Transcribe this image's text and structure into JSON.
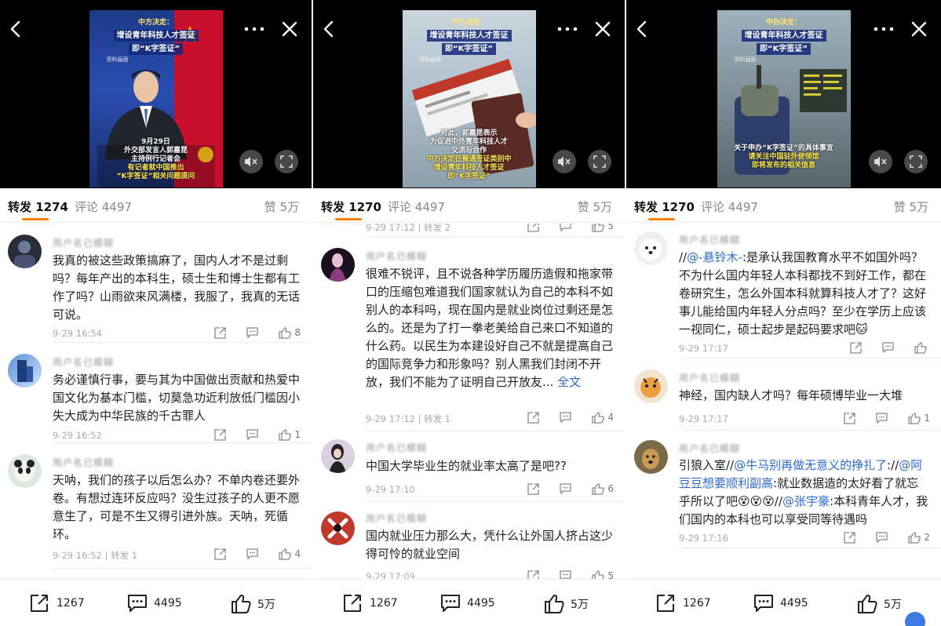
{
  "panels": [
    {
      "video": {
        "caption_top": [
          "中方决定：",
          "增设青年科技人才签证",
          "即“K字签证”"
        ],
        "watermark": "资料画面",
        "caption_bottom": [
          "9月29日",
          "外交部发言人郭嘉昆",
          "主持例行记者会",
          "有记者就中国推出",
          "“K字签证”相关问题提问"
        ]
      },
      "tabs": {
        "repost": "转发 1274",
        "comment": "评论 4497",
        "like": "赞 5万"
      },
      "comments": [
        {
          "name": "用户名已模糊",
          "text": "我真的被这些政策搞麻了，国内人才不是过剩吗？每年产出的本科生，硕士生和博士生都有工作了吗？山雨欲来风满楼，我服了，我真的无话可说。",
          "time": "9-29 16:54",
          "reposts": "",
          "likes": "8"
        },
        {
          "name": "用户名已模糊",
          "text": "务必谨慎行事，要与其为中国做出贡献和热爱中国文化为基本门槛，切莫急功近利放低门槛因小失大成为中华民族的千古罪人",
          "time": "9-29 16:52",
          "reposts": "",
          "likes": "1"
        },
        {
          "name": "用户名已模糊",
          "text": "天呐，我们的孩子以后怎么办？不单内卷还要外卷。有想过连环反应吗？没生过孩子的人更不愿意生了，可是不生又得引进外族。天呐，死循环。",
          "time": "9-29 16:52",
          "reposts": "转发 1",
          "likes": "4"
        }
      ],
      "bottom": {
        "repost": "1267",
        "comment": "4495",
        "like": "5万"
      }
    },
    {
      "video": {
        "caption_top": [
          "中方决定：",
          "增设青年科技人才签证",
          "即“K字签证”"
        ],
        "watermark": "资料画面",
        "caption_bottom": [
          "对此，郭嘉昆表示",
          "为促进中外青年科技人才",
          "交流与合作",
          "中方决定在普通签证类别中",
          "增设青年科技人才签证",
          "即“K字签证”"
        ]
      },
      "tabs": {
        "repost": "转发 1270",
        "comment": "评论 4497",
        "like": "赞 5万"
      },
      "top_meta": {
        "time": "9-29 17:12",
        "reposts": "转发 2",
        "likes": "5"
      },
      "comments": [
        {
          "name": "用户名已模糊",
          "text": "很难不锐评，且不说各种学历履历造假和拖家带口的压缩包难道我们国家就认为自己的本科不如别人的本科吗，现在国内是就业岗位过剩还是怎么的。还是为了打一拳老美给自己来口不知道的什么药。以民生为本建设好自己不就是提高自己的国际竞争力和形象吗？别人黑我们封闭不开放，我们不能为了证明自己开放友...",
          "more": "全文",
          "time": "9-29 17:12",
          "reposts": "转发 1",
          "likes": "4"
        },
        {
          "name": "用户名已模糊",
          "text": "中国大学毕业生的就业率太高了是吧??",
          "time": "9-29 17:10",
          "reposts": "",
          "likes": "6"
        },
        {
          "name": "用户名已模糊",
          "text": "国内就业压力那么大，凭什么让外国人挤占这少得可怜的就业空间",
          "time": "9-29 17:09",
          "reposts": "",
          "likes": "5"
        }
      ],
      "bottom": {
        "repost": "1267",
        "comment": "4495",
        "like": "5万"
      }
    },
    {
      "video": {
        "caption_top": [
          "中办决定：",
          "增设青年科技人才签证",
          "即“K字签证”"
        ],
        "watermark": "资料画面",
        "caption_bottom": [
          "关于申办“K字签证”的具体事宜",
          "请关注中国驻外使领馆",
          "即将发布的相关信息"
        ]
      },
      "tabs": {
        "repost": "转发 1270",
        "comment": "评论 4497",
        "like": "赞 5万"
      },
      "comments": [
        {
          "name": "用户名已模糊",
          "text_parts": [
            {
              "t": "//",
              "link": false
            },
            {
              "t": "@-悬铃木-",
              "link": true
            },
            {
              "t": ":是承认我国教育水平不如国外吗？不为什么国内年轻人本科都找不到好工作，都在卷研究生，怎么外国本科就算科技人才了？这好事儿能给国内年轻人分点吗？至少在学历上应该一视同仁，硕士起步是起码要求吧🐱",
              "link": false
            }
          ],
          "time": "9-29 17:17",
          "reposts": "",
          "likes": ""
        },
        {
          "name": "用户名已模糊",
          "text_parts": [
            {
              "t": "神经，国内缺人才吗？每年硕博毕业一大堆",
              "link": false
            }
          ],
          "time": "9-29 17:17",
          "reposts": "",
          "likes": "1"
        },
        {
          "name": "用户名已模糊",
          "text_parts": [
            {
              "t": "引狼入室//",
              "link": false
            },
            {
              "t": "@牛马别再做无意义的挣扎了",
              "link": true
            },
            {
              "t": "://",
              "link": false
            },
            {
              "t": "@阿豆豆想要顺利副高",
              "link": true
            },
            {
              "t": ":就业数据造的太好看了就忘乎所以了吧😵😵😵//",
              "link": false
            },
            {
              "t": "@张宇豪",
              "link": true
            },
            {
              "t": ":本科青年人才，我们国内的本科也可以享受同等待遇吗",
              "link": false
            }
          ],
          "time": "9-29 17:16",
          "reposts": "",
          "likes": "2"
        }
      ],
      "bottom": {
        "repost": "1267",
        "comment": "4495",
        "like": "5万"
      }
    }
  ]
}
